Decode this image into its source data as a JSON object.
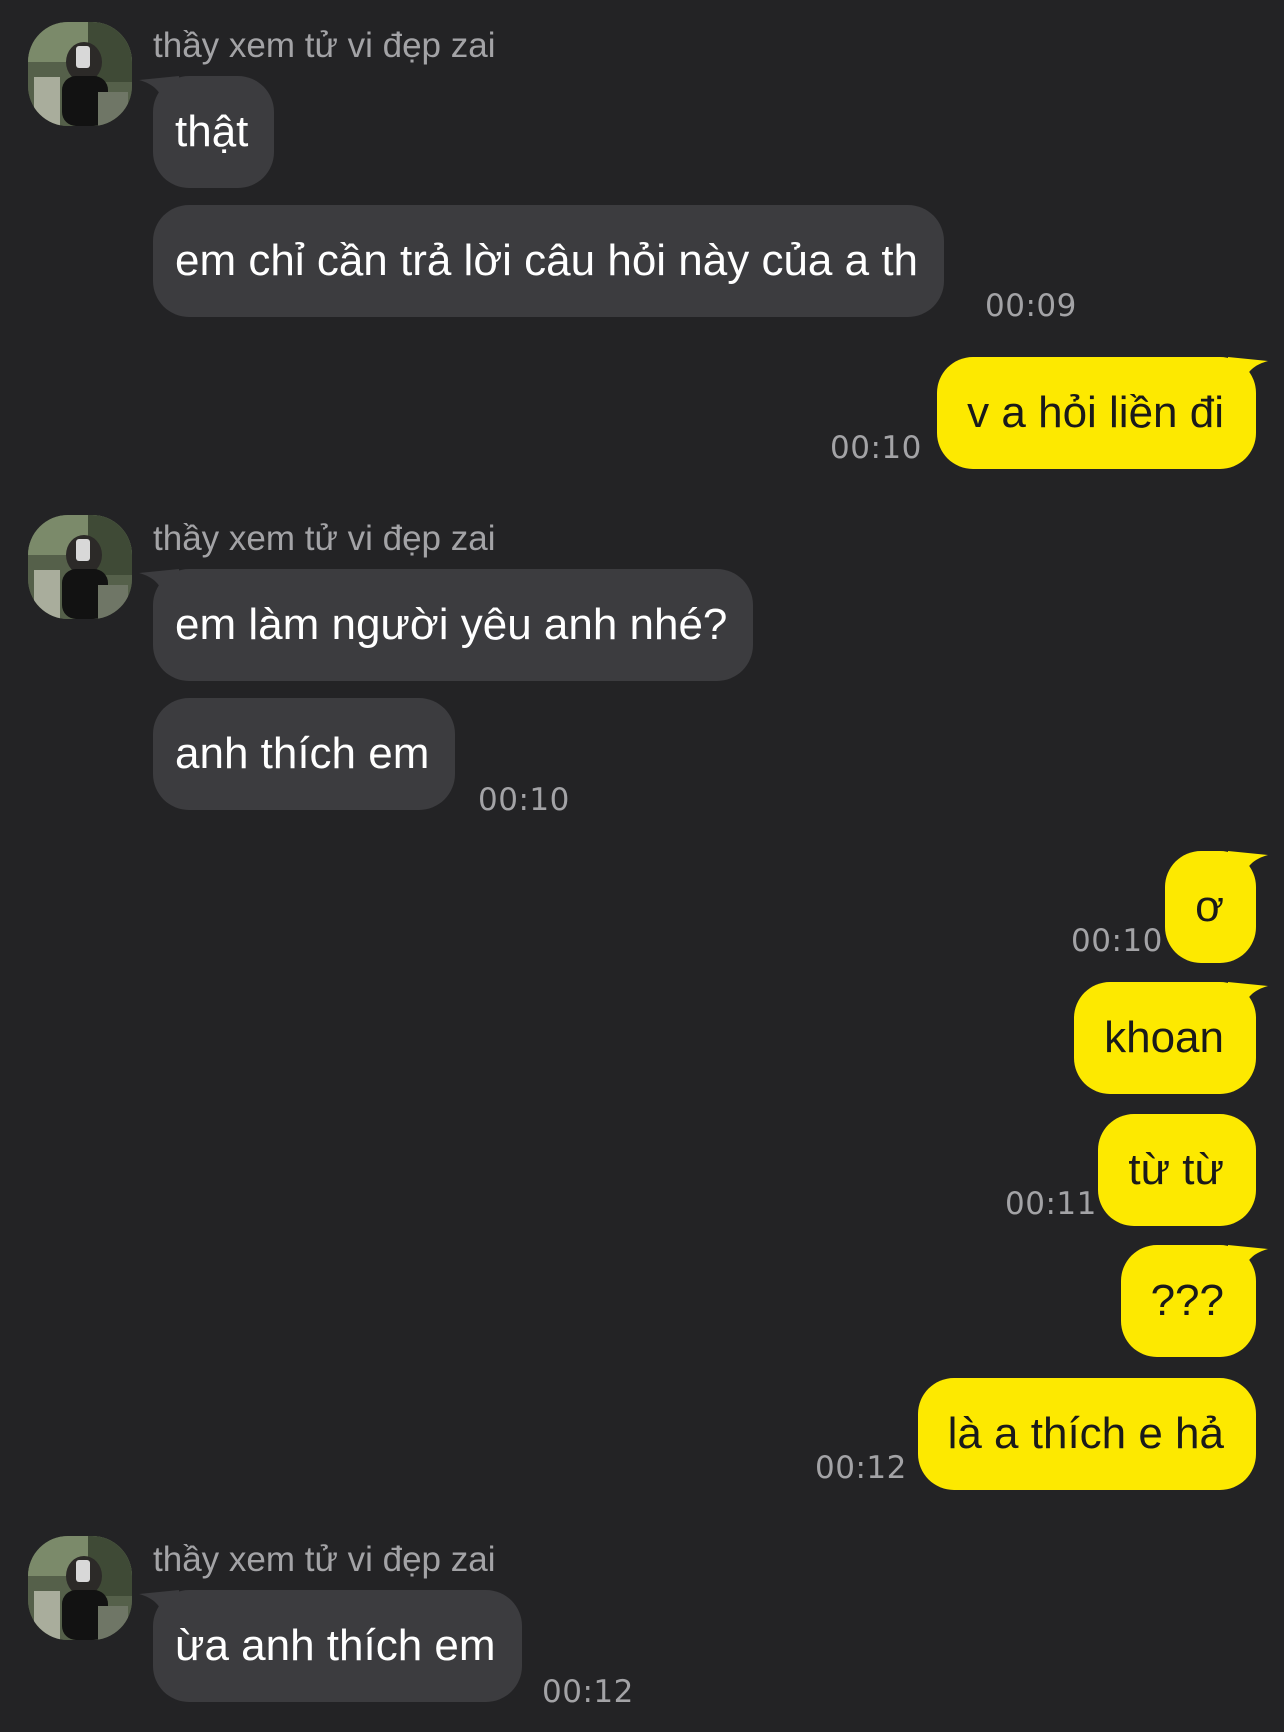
{
  "chat": {
    "sender_name": "thầy xem tử vi đẹp zai",
    "messages": [
      {
        "from": "them",
        "text": "thật"
      },
      {
        "from": "them",
        "text": "em chỉ cần trả lời câu hỏi này của a th",
        "time": "00:09"
      },
      {
        "from": "me",
        "text": "v a hỏi liền đi",
        "time": "00:10"
      },
      {
        "from": "them",
        "text": "em làm người yêu anh nhé?"
      },
      {
        "from": "them",
        "text": "anh thích em",
        "time": "00:10"
      },
      {
        "from": "me",
        "text": "ơ",
        "time": "00:10"
      },
      {
        "from": "me",
        "text": "khoan"
      },
      {
        "from": "me",
        "text": "từ từ",
        "time": "00:11"
      },
      {
        "from": "me",
        "text": "???"
      },
      {
        "from": "me",
        "text": "là a thích e hả",
        "time": "00:12"
      },
      {
        "from": "them",
        "text": "ừa anh thích em",
        "time": "00:12"
      }
    ]
  },
  "colors": {
    "background": "#232325",
    "incoming_bubble": "#3c3c3f",
    "outgoing_bubble": "#fde900",
    "meta_text": "#a3a3a6"
  },
  "icons": {
    "avatar": "profile-photo-avatar"
  }
}
